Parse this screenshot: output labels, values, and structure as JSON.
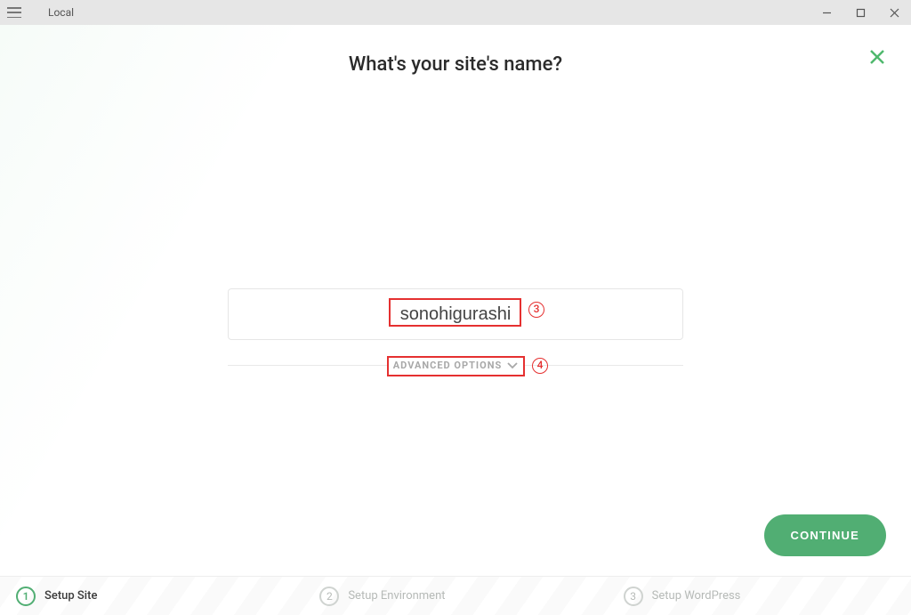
{
  "app": {
    "title": "Local"
  },
  "heading": "What's your site's name?",
  "input": {
    "value": "sonohigurashi"
  },
  "advanced_label": "ADVANCED OPTIONS",
  "continue_label": "CONTINUE",
  "annotations": {
    "input_num": "3",
    "adv_num": "4"
  },
  "steps": [
    {
      "num": "1",
      "label": "Setup Site",
      "active": true
    },
    {
      "num": "2",
      "label": "Setup Environment",
      "active": false
    },
    {
      "num": "3",
      "label": "Setup WordPress",
      "active": false
    }
  ]
}
